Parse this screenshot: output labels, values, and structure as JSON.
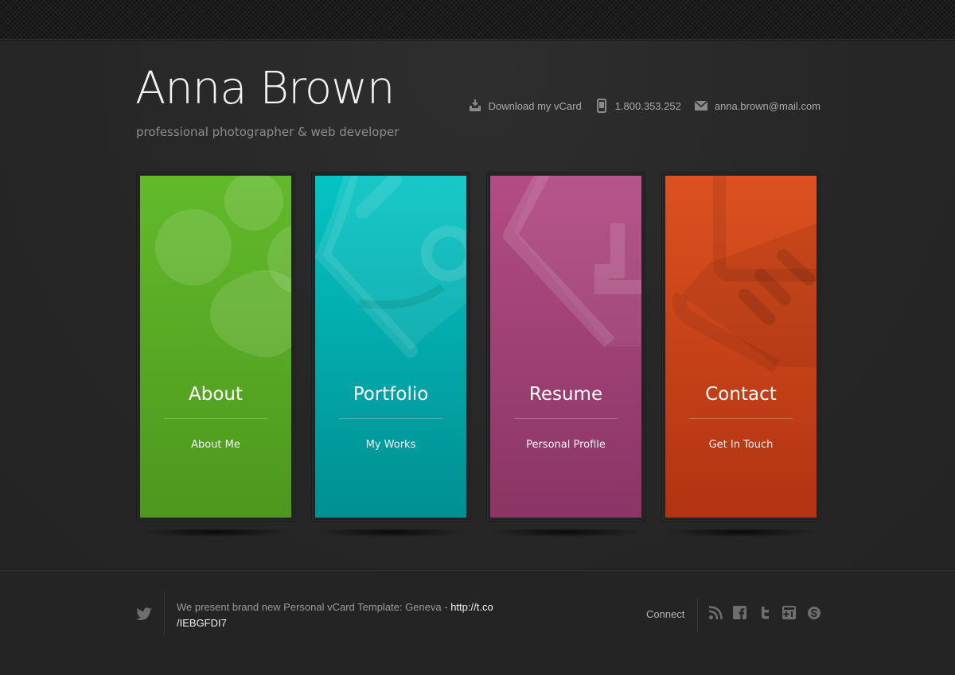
{
  "header": {
    "name": "Anna Brown",
    "tagline": "professional photographer & web developer"
  },
  "contact_bar": {
    "vcard_label": "Download my vCard",
    "phone": "1.800.353.252",
    "email": "anna.brown@mail.com",
    "icons": [
      "download-icon",
      "phone-icon",
      "mail-icon"
    ]
  },
  "tiles": [
    {
      "title": "About",
      "subtitle": "About Me",
      "color": "#5aa524",
      "icon": "paw-icon"
    },
    {
      "title": "Portfolio",
      "subtitle": "My Works",
      "color": "#04a9a9",
      "icon": "camera-icon"
    },
    {
      "title": "Resume",
      "subtitle": "Personal Profile",
      "color": "#a2457a",
      "icon": "tag-icon"
    },
    {
      "title": "Contact",
      "subtitle": "Get In Touch",
      "color": "#cd4416",
      "icon": "phone-handset-icon"
    }
  ],
  "footer": {
    "tweet_text": "We present brand new Personal vCard Template: Geneva - ",
    "tweet_link_part1": "http://t.co",
    "tweet_link_part2": "/IEBGFDI7",
    "connect_label": "Connect",
    "social_icons": [
      "rss-icon",
      "facebook-icon",
      "twitter-icon",
      "google-plus-icon",
      "skype-icon"
    ]
  }
}
